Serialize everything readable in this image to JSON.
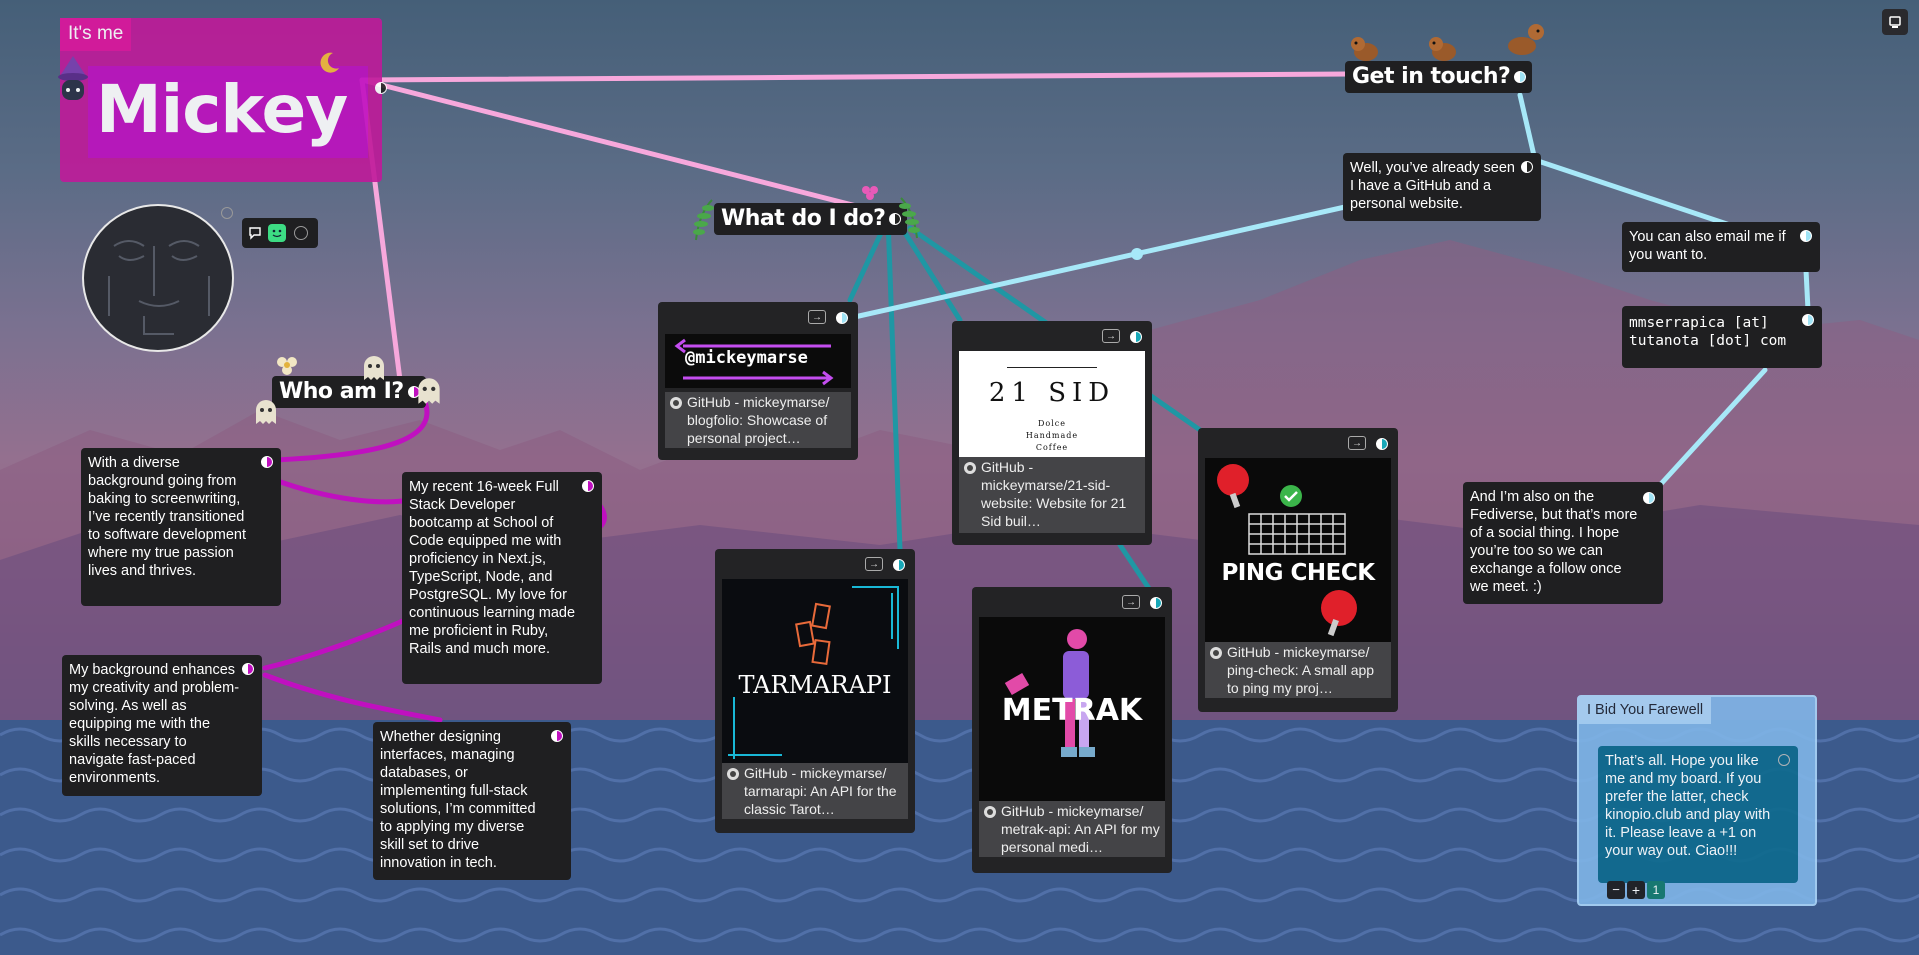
{
  "top_right_icon": "board-menu-icon",
  "mickey_box": {
    "label": "It's me",
    "name": "Mickey",
    "moon_icon": "crescent-moon-icon",
    "witch_icon": "witch-cat-sticker-icon"
  },
  "avatar": {
    "alt": "face doodle"
  },
  "avatar_tools": {
    "icons": [
      "speech-bubble-icon",
      "smiley-icon",
      "circle-icon"
    ]
  },
  "who": {
    "title": "Who am I?",
    "card1": "With a diverse background going from baking to screenwriting, I’ve recently transitioned to software development where my true passion lives and thrives.",
    "card2": "My recent 16-week Full Stack Developer bootcamp at School of Code equipped me with proficiency in Next.js, TypeScript, Node, and PostgreSQL. My love for continuous learning made me proficient in Ruby, Rails and much more.",
    "card3": "My background enhances my creativity and problem-solving. As well as equipping me with the skills necessary to navigate fast-paced environments.",
    "card4": "Whether designing interfaces, managing databases, or implementing full-stack solutions, I’m committed to applying my diverse skill set to drive innovation in tech."
  },
  "what": {
    "title": "What do I do?",
    "links": [
      {
        "thumb_text": "@mickeymarse",
        "meta": "GitHub - mickeymarse/ blogfolio: Showcase of personal project…"
      },
      {
        "thumb_text": "21 SID",
        "thumb_sub": "Dolce Handmade Coffee",
        "meta": "GitHub - mickeymarse/21-sid-website: Website for 21 Sid buil…"
      },
      {
        "thumb_text": "PING CHECK",
        "meta": "GitHub - mickeymarse/ ping-check: A small app to ping my proj…"
      },
      {
        "thumb_text": "TARMARAPI",
        "meta": "GitHub - mickeymarse/ tarmarapi: An API for the classic Tarot…"
      },
      {
        "thumb_text": "METRAK",
        "meta": "GitHub - mickeymarse/ metrak-api: An API for my personal medi…"
      }
    ],
    "arrow": "→"
  },
  "touch": {
    "title": "Get in touch?",
    "card1": "Well, you’ve already seen I have a GitHub and a personal website.",
    "card2": "You can also email me if you want to.",
    "email_line1": "mmserrapica [at]",
    "email_line2": "tutanota [dot] com",
    "card3": "And I’m also on the Fediverse, but that’s more of a social thing. I hope you’re too so we can exchange a follow once we meet. :)"
  },
  "farewell": {
    "label": "I Bid You Farewell",
    "text": "That’s all. Hope you like me and my board. If you prefer the latter, check kinopio.club and play with it. Please leave a +1 on your way out. Ciao!!!",
    "minus": "−",
    "plus": "+",
    "votes": "1"
  },
  "colors": {
    "pink_line": "#f7a8dc",
    "magenta_line": "#c010c0",
    "teal_line": "#1f97a4",
    "ice_line": "#a7e8f8",
    "farewell_bg": "#0f6b8f"
  }
}
